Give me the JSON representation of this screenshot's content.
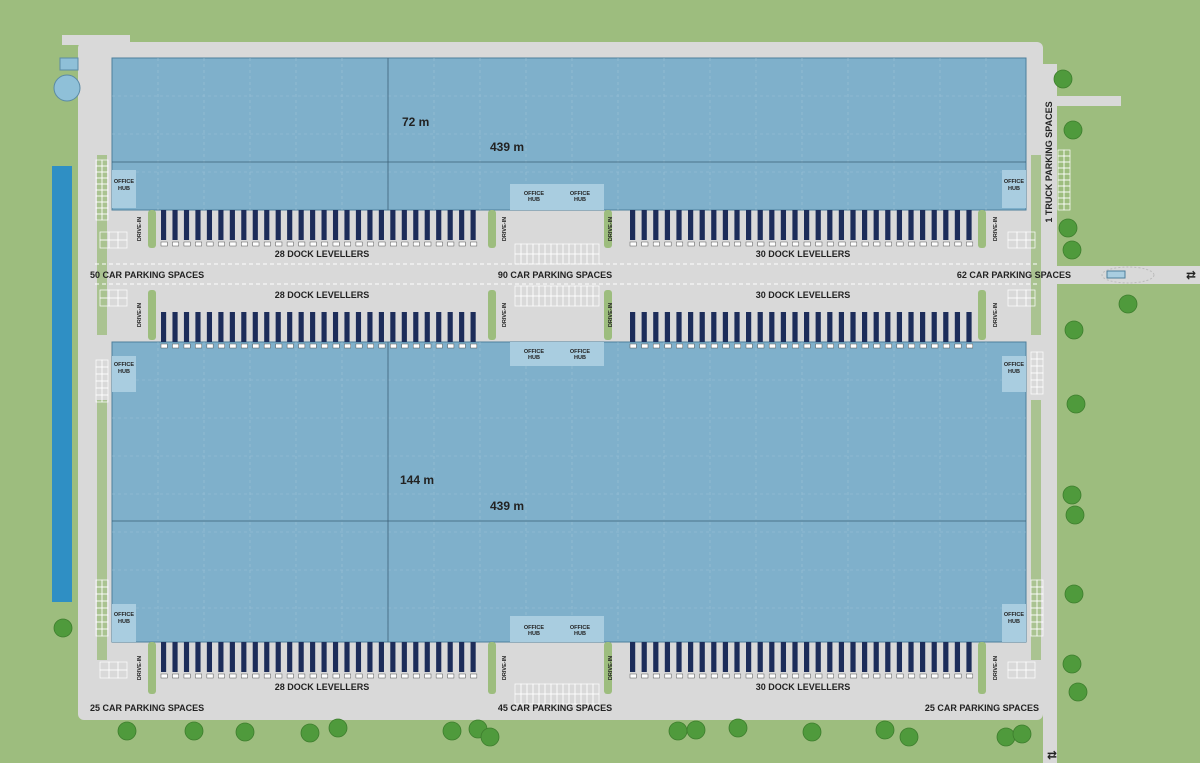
{
  "colors": {
    "grass": "#9dbd7e",
    "road": "#d7d7d7",
    "building": "#7fb0cb",
    "water": "#2f8fc4",
    "tree": "#4f9a3c",
    "dock": "#1d2d5a"
  },
  "buildings": {
    "north": {
      "width_label": "439 m",
      "depth_label": "72 m"
    },
    "south": {
      "width_label": "439 m",
      "depth_label": "144 m"
    }
  },
  "office_hub": {
    "line1": "OFFICE",
    "line2": "HUB"
  },
  "drive_in": "DRIVE-IN",
  "docks": {
    "north_left": "28 DOCK LEVELLERS",
    "north_right": "30 DOCK LEVELLERS",
    "mid_left": "28 DOCK LEVELLERS",
    "mid_right": "30 DOCK LEVELLERS",
    "south_left": "28 DOCK LEVELLERS",
    "south_right": "30 DOCK LEVELLERS"
  },
  "parking": {
    "mid_left": "50 CAR PARKING SPACES",
    "mid_center": "90 CAR PARKING SPACES",
    "mid_right": "62 CAR PARKING SPACES",
    "south_left": "25 CAR PARKING SPACES",
    "south_center": "45 CAR PARKING SPACES",
    "south_right": "25 CAR PARKING SPACES",
    "truck": "1 TRUCK PARKING SPACES"
  },
  "access_arrows": "⇄"
}
